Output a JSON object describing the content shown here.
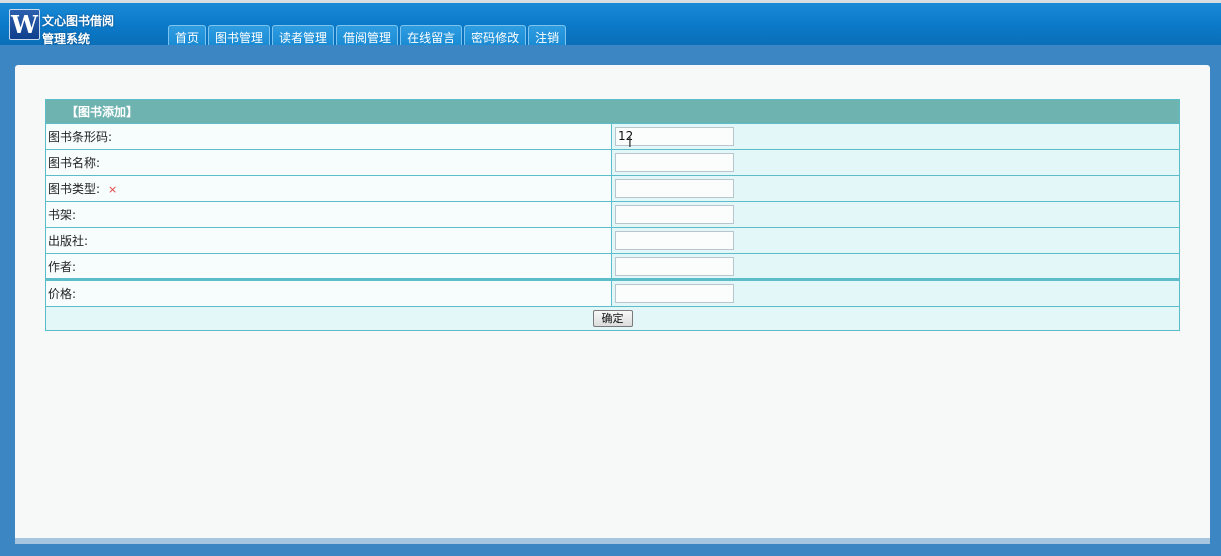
{
  "app": {
    "logo_letter": "W",
    "title_line1": "文心图书借阅",
    "title_line2": "管理系统"
  },
  "nav": {
    "tabs": [
      "首页",
      "图书管理",
      "读者管理",
      "借阅管理",
      "在线留言",
      "密码修改",
      "注销"
    ]
  },
  "form": {
    "title": "【图书添加】",
    "fields": [
      {
        "label": "图书条形码:",
        "value": "12",
        "required": false
      },
      {
        "label": "图书名称:",
        "value": "",
        "required": false
      },
      {
        "label": "图书类型:",
        "value": "",
        "required": true,
        "required_mark": "×"
      },
      {
        "label": "书架:",
        "value": "",
        "required": false
      },
      {
        "label": "出版社:",
        "value": "",
        "required": false
      },
      {
        "label": "作者:",
        "value": "",
        "required": false
      },
      {
        "label": "价格:",
        "value": "",
        "required": false
      }
    ],
    "submit_label": "确定"
  },
  "colors": {
    "header_blue": "#0b79c8",
    "title_row": "#6fb3b0",
    "row_bg": "#e3f7f8",
    "border": "#5cbcc8"
  }
}
